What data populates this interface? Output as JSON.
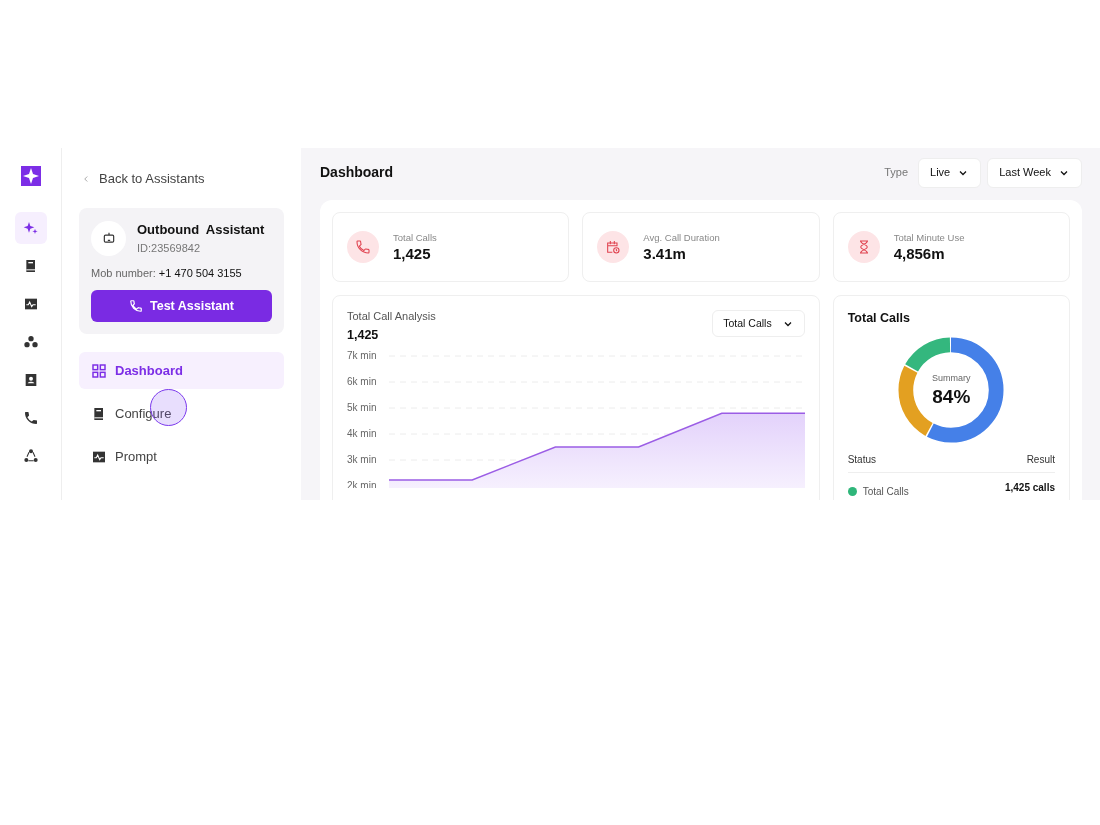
{
  "rail": {
    "items": [
      {
        "kind": "sparkle",
        "selected": true
      },
      {
        "kind": "book",
        "selected": false
      },
      {
        "kind": "pulse",
        "selected": false
      },
      {
        "kind": "cluster",
        "selected": false
      },
      {
        "kind": "contact",
        "selected": false
      },
      {
        "kind": "phone",
        "selected": false
      },
      {
        "kind": "share",
        "selected": false
      }
    ]
  },
  "sidebar": {
    "back_link": "Back to Assistants",
    "assistant": {
      "name": "Outbound  Assistant",
      "id": "ID:23569842",
      "mob_label": "Mob number:",
      "mob_number": "+1 470 504 3155"
    },
    "test_button": "Test Assistant",
    "nav": [
      {
        "label": "Dashboard",
        "kind": "grid",
        "selected": true
      },
      {
        "label": "Configure",
        "kind": "book",
        "selected": false
      },
      {
        "label": "Prompt",
        "kind": "pulse",
        "selected": false
      }
    ]
  },
  "header": {
    "title": "Dashboard",
    "type_label": "Type",
    "filters": [
      {
        "value": "Live"
      },
      {
        "value": "Last Week"
      }
    ]
  },
  "stats": [
    {
      "kind": "phone",
      "label": "Total Calls",
      "value": "1,425"
    },
    {
      "kind": "calendar",
      "label": "Avg. Call Duration",
      "value": "3.41m"
    },
    {
      "kind": "hourglass",
      "label": "Total Minute Use",
      "value": "4,856m"
    }
  ],
  "analysis": {
    "title": "Total Call Analysis",
    "total": "1,425",
    "chart_data": {
      "type": "area",
      "grid": true,
      "categories": [
        null,
        null,
        null,
        null,
        null,
        null
      ],
      "ylim": [
        2000,
        7000
      ],
      "yticks": [
        {
          "value": 2000,
          "label": "2k min"
        },
        {
          "value": 3000,
          "label": "3k min"
        },
        {
          "value": 4000,
          "label": "4k min"
        },
        {
          "value": 5000,
          "label": "5k min"
        },
        {
          "value": 6000,
          "label": "6k min"
        },
        {
          "value": 7000,
          "label": "7k min"
        }
      ],
      "series": [
        {
          "name": "Total Calls",
          "color": "#9b5de5",
          "values": [
            2230,
            2230,
            3500,
            3500,
            4800,
            4800
          ]
        }
      ]
    }
  },
  "total_calls": {
    "title": "Total Calls",
    "summary_label": "Summary",
    "percent": "84%",
    "status_header": "Status",
    "result_header": "Result",
    "rows": [
      {
        "label": "Total Calls",
        "value": "1,425 calls",
        "color": "#2fb67a"
      }
    ]
  }
}
